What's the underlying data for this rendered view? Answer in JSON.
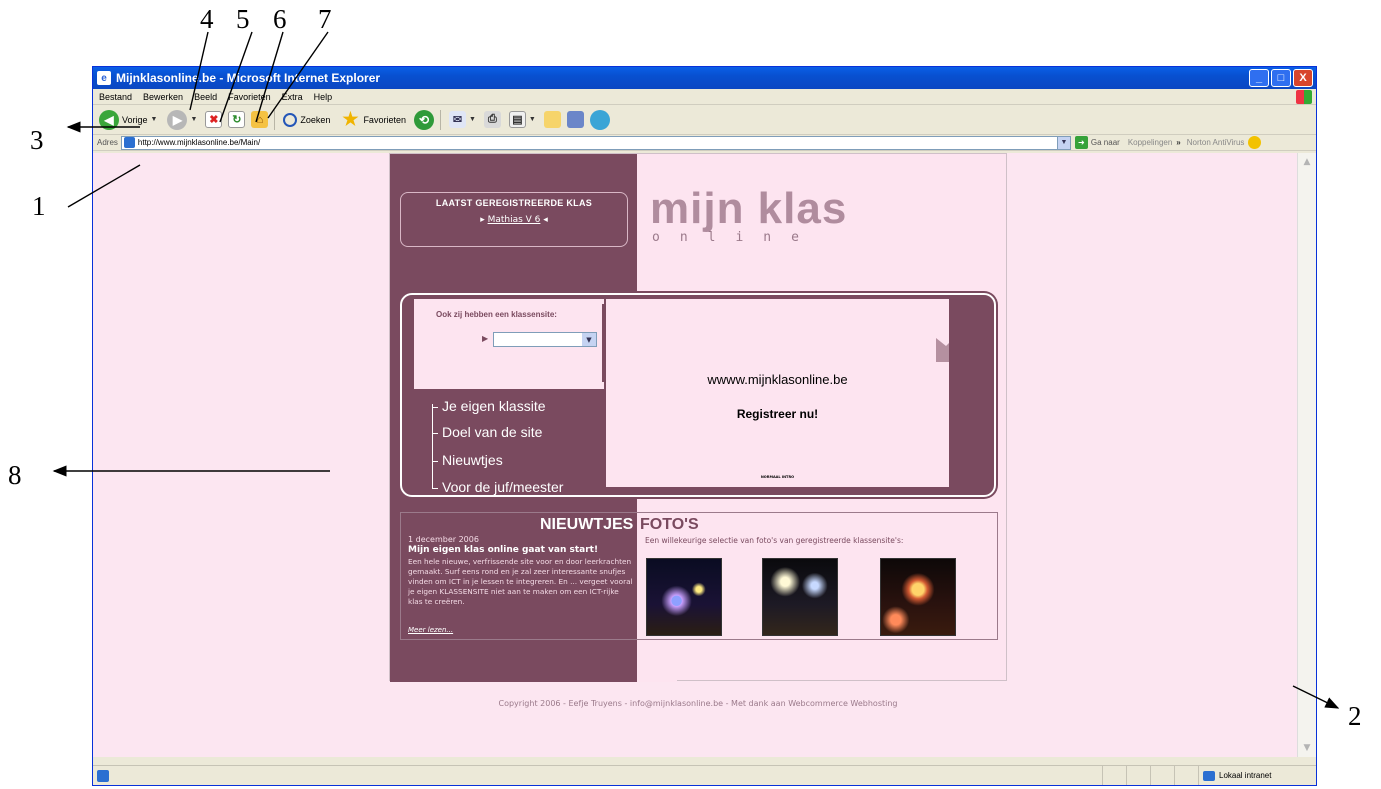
{
  "annotations": {
    "labels": [
      "4",
      "5",
      "6",
      "7",
      "3",
      "1",
      "8",
      "2"
    ]
  },
  "window": {
    "title": "Mijnklasonline.be - Microsoft Internet Explorer",
    "buttons": {
      "minimize": "_",
      "maximize": "□",
      "close": "X"
    }
  },
  "menu": {
    "items": [
      "Bestand",
      "Bewerken",
      "Beeld",
      "Favorieten",
      "Extra",
      "Help"
    ]
  },
  "toolbar": {
    "back_label": "Vorige",
    "search_label": "Zoeken",
    "favorites_label": "Favorieten"
  },
  "address": {
    "label": "Adres",
    "url": "http://www.mijnklasonline.be/Main/",
    "go_label": "Ga naar",
    "links_label": "Koppelingen",
    "norton_label": "Norton AntiVirus"
  },
  "status": {
    "zone": "Lokaal intranet"
  },
  "site": {
    "registered_title": "LAATST GEREGISTREERDE KLAS",
    "registered_name": "Mathias V 6",
    "logo_main": "mijn klas",
    "logo_sub": "online",
    "classsite_title": "Ook zij hebben een klassensite:",
    "promo_url": "wwww.mijnklasonline.be",
    "promo_register": "Registreer nu!",
    "promo_skip": "NORMAAL INTRO",
    "nav": [
      "Je eigen klassite",
      "Doel van de site",
      "Nieuwtjes",
      "Voor de juf/meester"
    ],
    "news_title": "NIEUWTJES",
    "fotos_title": "FOTO'S",
    "news_date": "1 december 2006",
    "news_headline": "Mijn eigen klas online gaat van start!",
    "news_body": "Een hele nieuwe, verfrissende site voor en door leerkrachten gemaakt. Surf eens rond en je zal zeer interessante snufjes vinden om ICT in je lessen te integreren. En ... vergeet vooral je eigen KLASSENSITE niet aan te maken om een ICT-rijke klas te creëren.",
    "news_more": "Meer lezen...",
    "fotos_subtitle": "Een willekeurige selectie van foto's van geregistreerde klassensite's:",
    "copyright": "Copyright 2006 - Eefje Truyens - info@mijnklasonline.be - Met dank aan Webcommerce Webhosting"
  }
}
